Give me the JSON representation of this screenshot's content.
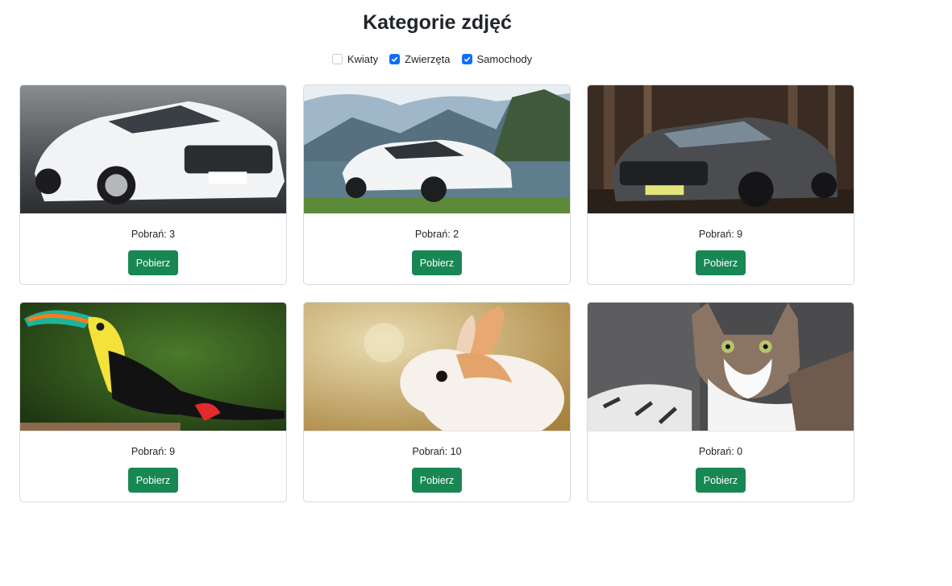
{
  "page": {
    "title": "Kategorie zdjęć"
  },
  "filters": [
    {
      "label": "Kwiaty",
      "checked": false
    },
    {
      "label": "Zwierzęta",
      "checked": true
    },
    {
      "label": "Samochody",
      "checked": true
    }
  ],
  "cards": [
    {
      "photo": "white-mercedes-coupe-photo",
      "downloads": "Pobrań: 3",
      "button": "Pobierz"
    },
    {
      "photo": "white-mercedes-sedan-lake-photo",
      "downloads": "Pobrań: 2",
      "button": "Pobierz"
    },
    {
      "photo": "dark-mercedes-forest-photo",
      "downloads": "Pobrań: 9",
      "button": "Pobierz"
    },
    {
      "photo": "toucan-photo",
      "downloads": "Pobrań: 9",
      "button": "Pobierz"
    },
    {
      "photo": "rabbit-photo",
      "downloads": "Pobrań: 10",
      "button": "Pobierz"
    },
    {
      "photo": "cat-photo",
      "downloads": "Pobrań: 0",
      "button": "Pobierz"
    }
  ],
  "colors": {
    "accent": "#0d6efd",
    "button": "#198754"
  }
}
